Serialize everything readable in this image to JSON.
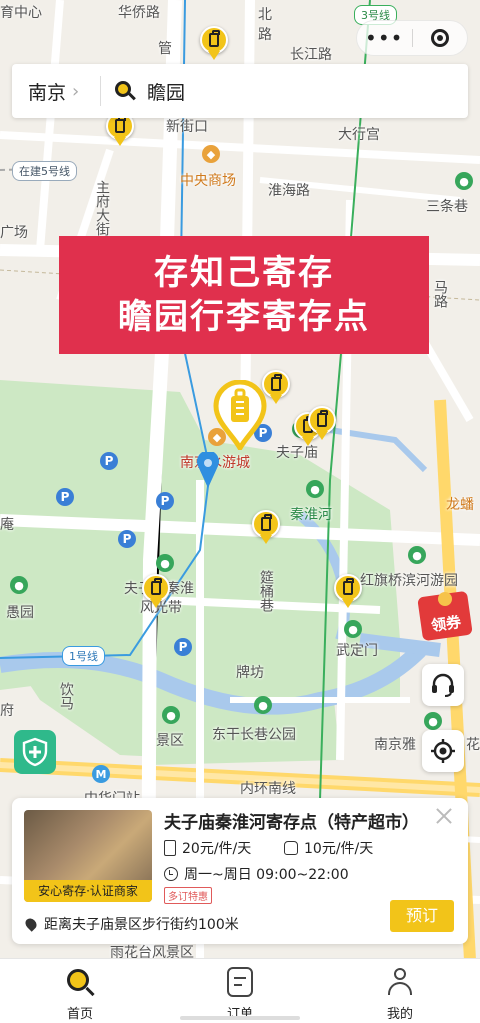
{
  "search": {
    "city": "南京",
    "query": "瞻园"
  },
  "capsule": {
    "more": "•••"
  },
  "banner": {
    "line1": "存知己寄存",
    "line2": "瞻园行李寄存点"
  },
  "map_labels": {
    "tiyu": "育中心",
    "huaqiao": "华侨路",
    "bei": "北",
    "lu": "路",
    "guan": "管",
    "changjiang": "长江路",
    "dahanggong": "大行宫",
    "xinjiekou": "新街口",
    "zaijian5": "在建5号线",
    "line3": "3号线",
    "zhongyang": "中央商场",
    "huaihai": "淮海路",
    "zhufu": "主府大街",
    "guangchang": "广场",
    "santiao": "三条巷",
    "ma_lu": "马路",
    "fuzimiao_area": "夫子庙",
    "nanjing_yule": "南京水游城",
    "qinhuai": "秦淮河",
    "longfan": "龙蟠",
    "an": "庵",
    "yu_yuan": "愚园",
    "fuzi_qinhuai": "夫子庙秦淮",
    "fengguang": "风光带",
    "shuangqiao": "筵桶巷",
    "hongqiqiao": "红旗桥滨河游园",
    "wuding": "武定门",
    "line1": "1号线",
    "yin": "饮马",
    "paifang": "牌坊",
    "jingqu": "景区",
    "donggan": "东干长巷公园",
    "nanjingya": "南京雅",
    "hua": "花",
    "neihuan": "内环南线",
    "zhonghua": "中华门站",
    "yuhuatai": "雨花台风景区",
    "fu": "府"
  },
  "coupon": {
    "label": "领券"
  },
  "card": {
    "badge": "安心寄存·认证商家",
    "title": "夫子庙秦淮河寄存点（特产超市）",
    "price_large": "20元/件/天",
    "price_small": "10元/件/天",
    "hours": "周一~周日 09:00~22:00",
    "tag": "多订特惠",
    "distance": "距离夫子庙景区步行街约100米",
    "book": "预订"
  },
  "tabs": [
    {
      "label": "首页"
    },
    {
      "label": "订单"
    },
    {
      "label": "我的"
    }
  ],
  "colors": {
    "accent": "#f2c419",
    "banner": "#e0304d",
    "park": "#cde8c4",
    "road": "#ffffff",
    "metro_green": "#3aaf5c",
    "metro_blue": "#3a9be0"
  }
}
